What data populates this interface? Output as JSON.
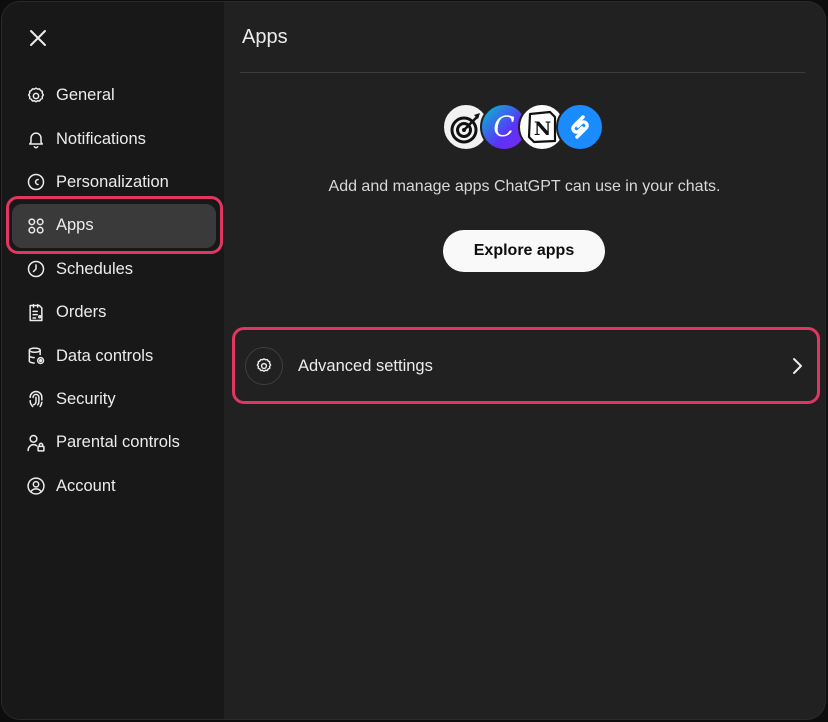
{
  "sidebar": {
    "close_icon": "close-icon",
    "items": [
      {
        "label": "General",
        "icon": "gear-icon"
      },
      {
        "label": "Notifications",
        "icon": "bell-icon"
      },
      {
        "label": "Personalization",
        "icon": "personalization-icon"
      },
      {
        "label": "Apps",
        "icon": "apps-grid-icon",
        "active": true
      },
      {
        "label": "Schedules",
        "icon": "clock-icon"
      },
      {
        "label": "Orders",
        "icon": "receipt-icon"
      },
      {
        "label": "Data controls",
        "icon": "database-icon"
      },
      {
        "label": "Security",
        "icon": "fingerprint-icon"
      },
      {
        "label": "Parental controls",
        "icon": "parental-icon"
      },
      {
        "label": "Account",
        "icon": "account-icon"
      }
    ]
  },
  "main": {
    "title": "Apps",
    "description": "Add and manage apps ChatGPT can use in your chats.",
    "explore_button": "Explore apps",
    "app_logos": [
      "target-app-logo",
      "canva-logo",
      "notion-logo",
      "shazam-logo"
    ],
    "advanced_settings": {
      "label": "Advanced settings",
      "icon": "gear-icon",
      "trailing_icon": "chevron-right-icon"
    }
  },
  "colors": {
    "window_bg": "#212121",
    "sidebar_bg": "#181818",
    "active_item_bg": "#3a3a3a",
    "highlight_border": "#e0365f",
    "button_bg": "#f9f9f9",
    "text": "#ececec"
  }
}
